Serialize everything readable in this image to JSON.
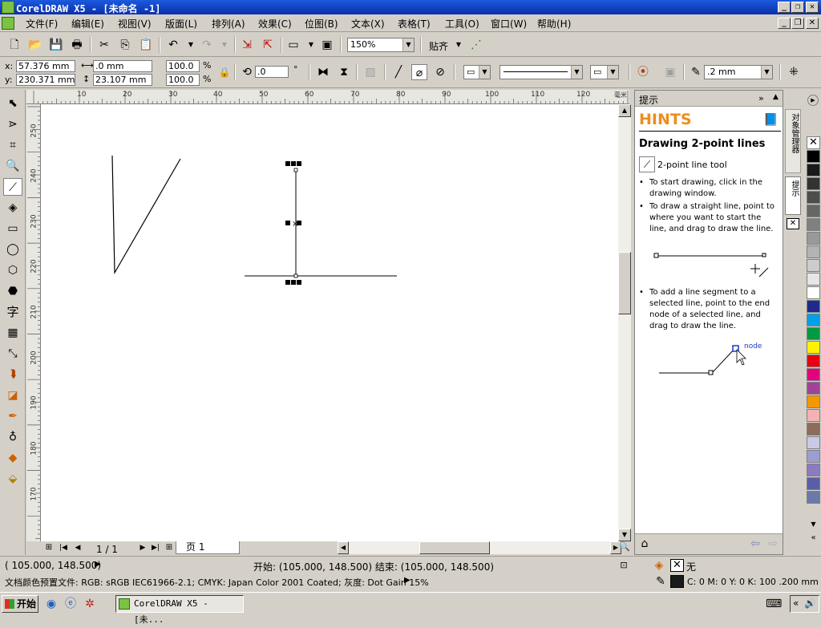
{
  "window": {
    "title": "CorelDRAW X5 - [未命名 -1]"
  },
  "menu": {
    "items": [
      "文件(F)",
      "编辑(E)",
      "视图(V)",
      "版面(L)",
      "排列(A)",
      "效果(C)",
      "位图(B)",
      "文本(X)",
      "表格(T)",
      "工具(O)",
      "窗口(W)",
      "帮助(H)"
    ]
  },
  "standard_bar": {
    "zoom": "150%",
    "snap_label": "贴齐"
  },
  "property_bar": {
    "x_label": "x:",
    "x_value": "57.376 mm",
    "y_label": "y:",
    "y_value": "230.371 mm",
    "w_value": ".0 mm",
    "h_value": "23.107 mm",
    "scale_x": "100.0",
    "scale_y": "100.0",
    "percent": "%",
    "angle": ".0",
    "degree": "°",
    "outline_width": ".2 mm"
  },
  "rulers": {
    "h_ticks": [
      "10",
      "20",
      "30",
      "40",
      "50",
      "60",
      "70",
      "80",
      "90",
      "100",
      "110",
      "120"
    ],
    "h_units": "毫米",
    "v_ticks": [
      "250",
      "240",
      "230",
      "220",
      "210",
      "200",
      "190",
      "180",
      "170"
    ]
  },
  "page_nav": {
    "counter": "1 / 1",
    "page_tab": "页 1"
  },
  "docker": {
    "title": "提示",
    "hints_heading": "HINTS",
    "section_title": "Drawing 2-point lines",
    "tool_name": "2-point line tool",
    "bullets": [
      "To start drawing, click in the drawing window.",
      "To draw a straight line, point to where you want to start the line, and drag to draw the line.",
      "To add a line segment to a selected line, point to the end node of a selected line, and drag to draw the line."
    ],
    "node_label": "node"
  },
  "side_tabs": {
    "objects": "对象管理器",
    "hints": "提示"
  },
  "palette": {
    "colors": [
      "#000000",
      "#1a1a1a",
      "#333333",
      "#4d4d4d",
      "#666666",
      "#808080",
      "#999999",
      "#b3b3b3",
      "#cccccc",
      "#e6e6e6",
      "#ffffff",
      "#1f2b8c",
      "#00a0e9",
      "#009944",
      "#fff100",
      "#e60012",
      "#e4007f",
      "#a0449a",
      "#f39800",
      "#f5b2b2",
      "#8c6c5a",
      "#c9c9e6",
      "#9d9ed0",
      "#8b7bc0",
      "#5b5ea6",
      "#6a79a8"
    ]
  },
  "status": {
    "coords": "( 105.000, 148.500)",
    "start_end": "开始: (105.000, 148.500) 结束: (105.000, 148.500)",
    "fill_none": "无",
    "color_profile": "文档颜色预置文件: RGB: sRGB IEC61966-2.1; CMYK: Japan Color 2001 Coated; 灰度: Dot Gain 15%",
    "outline_info": "C: 0 M: 0 Y: 0 K: 100  .200 mm"
  },
  "taskbar": {
    "start": "开始",
    "task": "CorelDRAW X5 - [未..."
  }
}
